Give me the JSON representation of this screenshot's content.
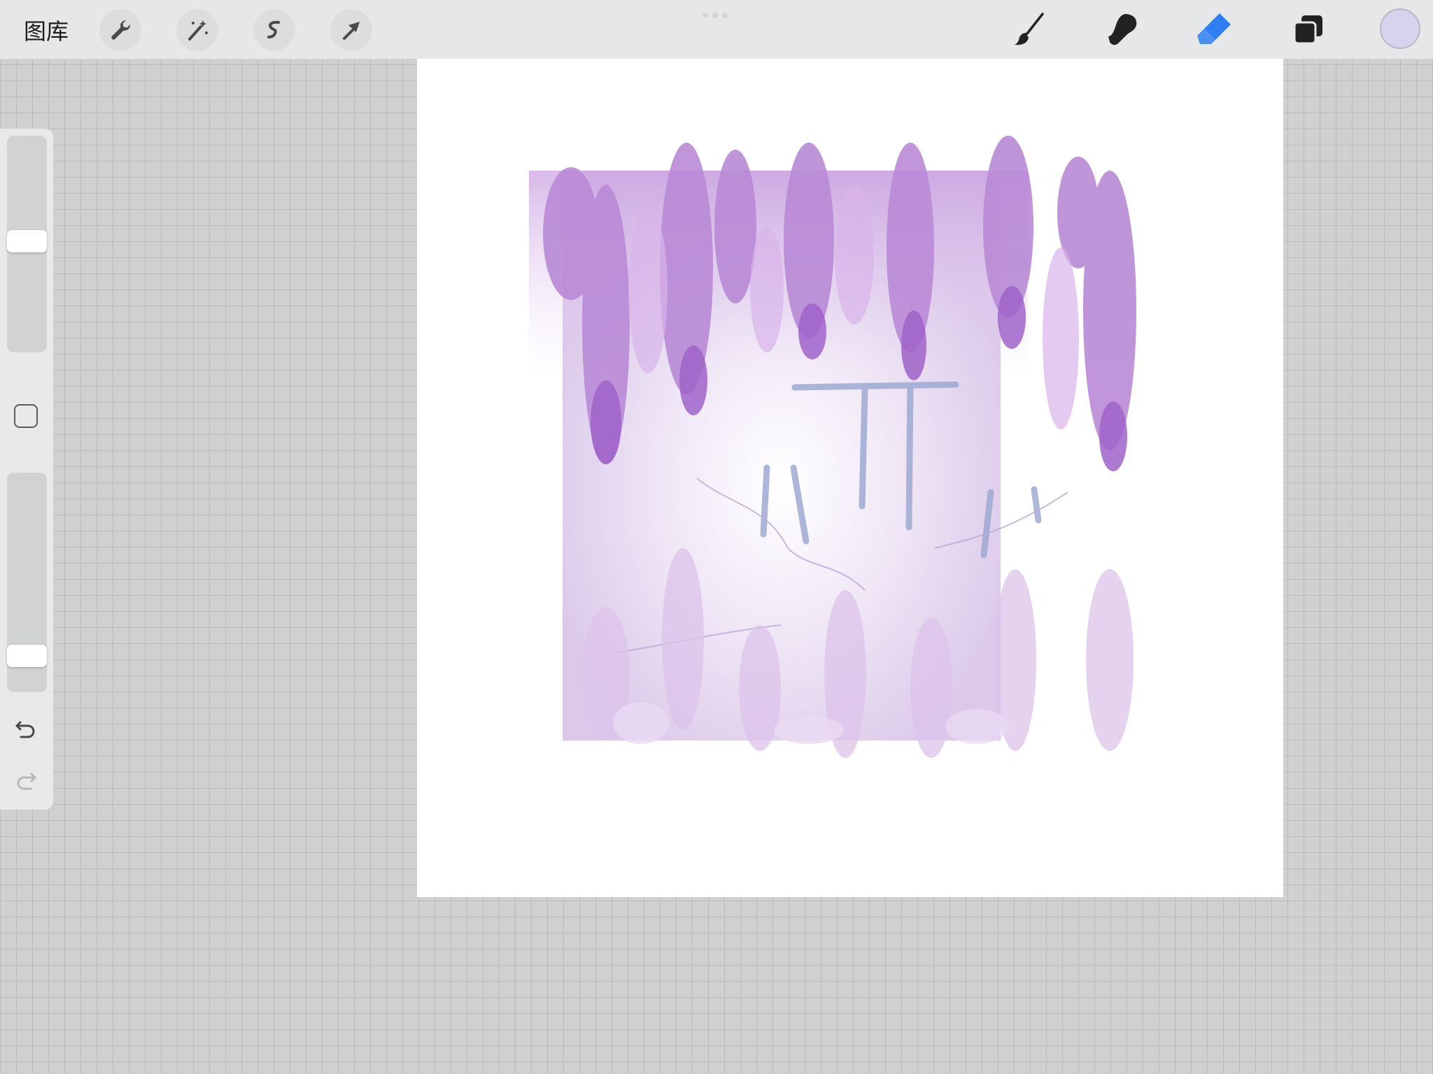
{
  "topbar": {
    "gallery_label": "图库",
    "left_tools": [
      "wrench-icon",
      "magic-wand-icon",
      "selection-icon",
      "transform-arrow-icon"
    ],
    "right_tools": [
      "brush-icon",
      "smudge-icon",
      "eraser-icon",
      "layers-icon"
    ],
    "active_tool": "eraser-icon",
    "accent_color": "#2f7ff2",
    "current_color": "#d5d3ee"
  },
  "sidebar": {
    "brush_size_level": 0.55,
    "opacity_level": 0.18,
    "undo": "undo-icon",
    "redo": "redo-icon"
  },
  "canvas": {
    "background": "#ffffff",
    "artwork": "wisteria-painting"
  }
}
